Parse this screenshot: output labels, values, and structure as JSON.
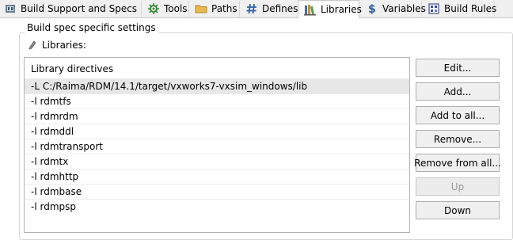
{
  "tabs": [
    {
      "label": "Build Support and Specs",
      "icon": "build-support-icon",
      "active": false
    },
    {
      "label": "Tools",
      "icon": "tools-icon",
      "active": false
    },
    {
      "label": "Paths",
      "icon": "folder-icon",
      "active": false
    },
    {
      "label": "Defines",
      "icon": "hash-icon",
      "active": false
    },
    {
      "label": "Libraries",
      "icon": "libraries-icon",
      "active": true
    },
    {
      "label": "Variables",
      "icon": "dollar-icon",
      "active": false
    },
    {
      "label": "Build Rules",
      "icon": "build-rules-icon",
      "active": false
    }
  ],
  "group": {
    "title": "Build spec specific settings",
    "libraries_label": "Libraries:"
  },
  "list": {
    "header": "Library directives",
    "items": [
      "-L C:/Raima/RDM/14.1/target/vxworks7-vxsim_windows/lib",
      "-l rdmtfs",
      "-l rdmrdm",
      "-l rdmddl",
      "-l rdmtransport",
      "-l rdmtx",
      "-l rdmhttp",
      "-l rdmbase",
      "-l rdmpsp"
    ],
    "selected_index": 0
  },
  "buttons": {
    "edit": "Edit...",
    "add": "Add...",
    "add_to_all": "Add to all...",
    "remove": "Remove...",
    "remove_from_all": "Remove from all...",
    "up": "Up",
    "down": "Down"
  },
  "buttons_disabled": [
    "up"
  ]
}
